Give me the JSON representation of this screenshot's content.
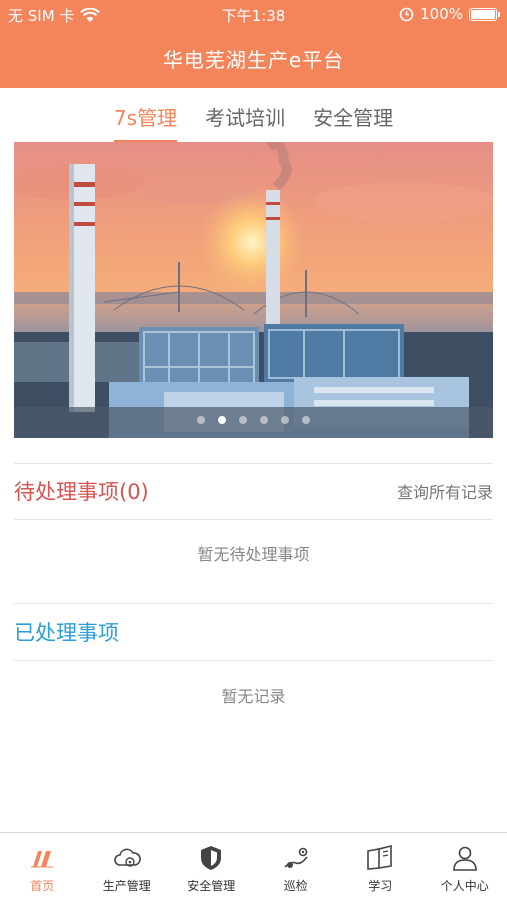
{
  "status_bar": {
    "carrier": "无 SIM 卡",
    "time": "下午1:38",
    "battery": "100%",
    "icons": [
      "wifi-icon",
      "alarm-icon",
      "battery-icon"
    ]
  },
  "header": {
    "title": "华电芜湖生产e平台"
  },
  "tabs": [
    {
      "label": "7s管理",
      "active": true
    },
    {
      "label": "考试培训",
      "active": false
    },
    {
      "label": "安全管理",
      "active": false
    }
  ],
  "banner": {
    "slide_count": 6,
    "active_slide": 2
  },
  "pending": {
    "title": "待处理事项(0)",
    "link": "查询所有记录",
    "empty_text": "暂无待处理事项"
  },
  "done": {
    "title": "已处理事项",
    "empty_text": "暂无记录"
  },
  "bottom_nav": [
    {
      "label": "首页",
      "icon": "home-logo-icon",
      "active": true
    },
    {
      "label": "生产管理",
      "icon": "cloud-production-icon",
      "active": false
    },
    {
      "label": "安全管理",
      "icon": "shield-icon",
      "active": false
    },
    {
      "label": "巡检",
      "icon": "inspection-icon",
      "active": false
    },
    {
      "label": "学习",
      "icon": "book-icon",
      "active": false
    },
    {
      "label": "个人中心",
      "icon": "person-icon",
      "active": false
    }
  ],
  "colors": {
    "brand": "#f4845a",
    "pending_title": "#d9534f",
    "done_title": "#2b9fd6"
  }
}
